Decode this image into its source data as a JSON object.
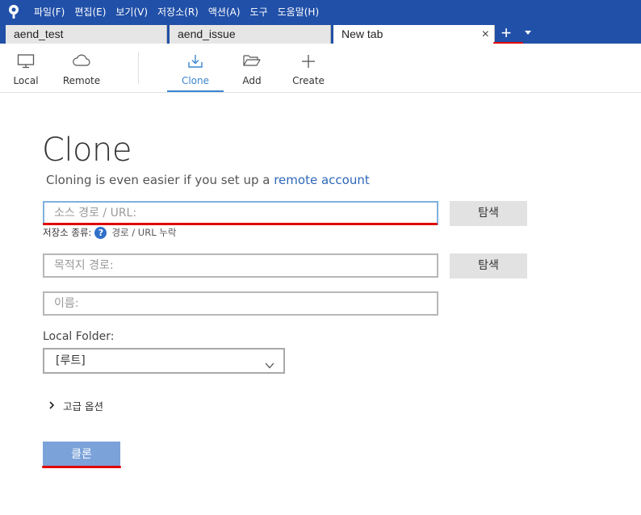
{
  "menu": {
    "items": [
      "파일(F)",
      "편집(E)",
      "보기(V)",
      "저장소(R)",
      "액션(A)",
      "도구",
      "도움말(H)"
    ]
  },
  "tabs": [
    {
      "label": "aend_test",
      "active": false
    },
    {
      "label": "aend_issue",
      "active": false
    },
    {
      "label": "New tab",
      "active": true
    }
  ],
  "tab_controls": {
    "close": "×",
    "add": "+"
  },
  "toolbar": {
    "local": "Local",
    "remote": "Remote",
    "clone": "Clone",
    "add": "Add",
    "create": "Create"
  },
  "page": {
    "title": "Clone",
    "subtitle_prefix": "Cloning is even easier if you set up a ",
    "subtitle_link": "remote account"
  },
  "form": {
    "source_placeholder": "소스 경로 / URL:",
    "source_browse": "탐색",
    "repo_type_label": "저장소 종류:",
    "repo_type_help": "?",
    "repo_type_msg": "경로 / URL 누락",
    "dest_placeholder": "목적지 경로:",
    "dest_browse": "탐색",
    "name_placeholder": "이름:",
    "local_folder_label": "Local Folder:",
    "local_folder_value": "[루트]",
    "advanced_label": "고급 옵션",
    "clone_button": "클론"
  },
  "colors": {
    "menubar": "#2150a8",
    "accent": "#3a86cf",
    "link": "#2e68b8",
    "clone_button": "#7ba2d9",
    "annotation": "#e00000"
  }
}
